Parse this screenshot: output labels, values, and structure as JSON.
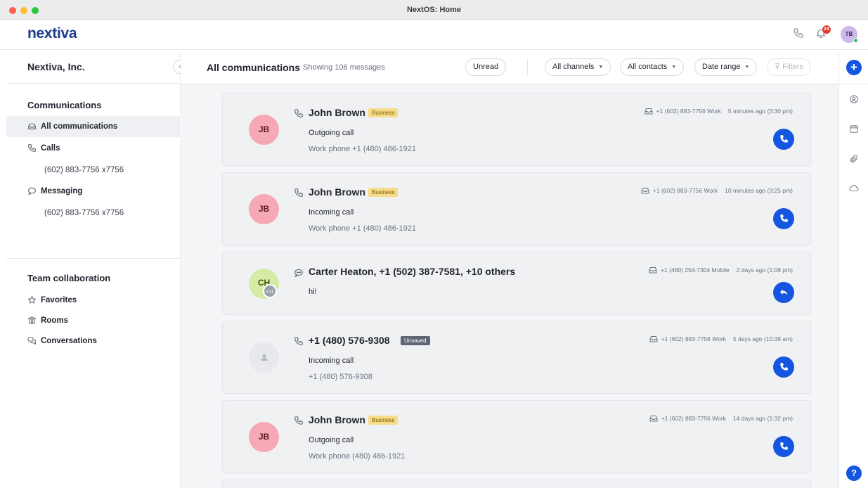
{
  "window": {
    "title": "NextOS: Home"
  },
  "header": {
    "logo": "nextiva",
    "notification_count": "24",
    "user_initials": "TB",
    "icons": [
      "phone-icon",
      "bell-icon"
    ]
  },
  "sidebar": {
    "org_name": "Nextiva, Inc.",
    "sections": {
      "communications": "Communications",
      "team": "Team collaboration"
    },
    "items": [
      {
        "label": "All communications",
        "icon": "inbox-icon",
        "active": true
      },
      {
        "label": "Calls",
        "icon": "phone-icon"
      },
      {
        "label": "(602) 883-7756 x7756"
      },
      {
        "label": "Messaging",
        "icon": "chat-bubble-icon"
      },
      {
        "label": "(602) 883-7756 x7756"
      }
    ],
    "team_items": [
      {
        "label": "Favorites",
        "icon": "star-icon"
      },
      {
        "label": "Rooms",
        "icon": "rooms-icon"
      },
      {
        "label": "Conversations",
        "icon": "conversations-icon"
      }
    ]
  },
  "toolbar": {
    "title": "All communications",
    "count": "Showing 106 messages",
    "filters": {
      "unread": "Unread",
      "channels": "All channels",
      "contacts": "All contacts",
      "date": "Date range",
      "more": "Filters"
    }
  },
  "communications": [
    {
      "initials": "JB",
      "type": "call",
      "name": "John Brown",
      "tag": "Business",
      "line1": "Outgoing call",
      "line2": "Work phone +1 (480) 486-1921",
      "channel": "+1 (602) 883-7756 Work",
      "time": "5 minutes ago (3:30 pm)",
      "action": "call"
    },
    {
      "initials": "JB",
      "type": "call",
      "name": "John Brown",
      "tag": "Business",
      "line1": "Incoming call",
      "line2": "Work phone +1 (480) 486-1921",
      "channel": "+1 (602) 883-7756 Work",
      "time": "10 minutes ago (3:25 pm)",
      "action": "call"
    },
    {
      "initials": "CH",
      "extra_count": "+11",
      "type": "message",
      "name": "Carter Heaton, +1 (502) 387-7581, +10 others",
      "line1": "hi!",
      "channel": "+1 (480) 254-7304 Mobile",
      "time": "2 days ago (1:08 pm)",
      "action": "reply"
    },
    {
      "initials": "",
      "type": "call",
      "name": "+1 (480) 576-9308",
      "tag": "Unsaved",
      "line1": "Incoming call",
      "line2": "+1 (480) 576-9308",
      "channel": "+1 (602) 883-7756 Work",
      "time": "5 days ago (10:38 am)",
      "action": "call"
    },
    {
      "initials": "JB",
      "type": "call",
      "name": "John Brown",
      "tag": "Business",
      "line1": "Outgoing call",
      "line2": "Work phone (480) 486-1921",
      "channel": "+1 (602) 883-7756 Work",
      "time": "14 days ago (1:32 pm)",
      "action": "call"
    }
  ],
  "rail": {
    "add_label": "+",
    "help_label": "?",
    "icons": [
      "contact-icon",
      "calendar-icon",
      "attachment-icon",
      "cloud-icon"
    ]
  },
  "colors": {
    "accent": "#1556e0",
    "business_tag": "#f7dc8a",
    "unsaved_tag": "#5f6675",
    "avatar_pink": "#f6a8b4",
    "avatar_green": "#d5eba6"
  }
}
